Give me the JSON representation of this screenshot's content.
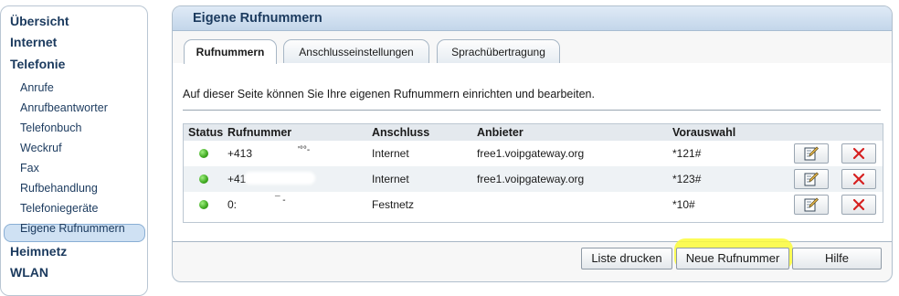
{
  "sidebar": {
    "items": [
      {
        "label": "Übersicht"
      },
      {
        "label": "Internet"
      },
      {
        "label": "Telefonie"
      },
      {
        "label": "Anrufe"
      },
      {
        "label": "Anrufbeantworter"
      },
      {
        "label": "Telefonbuch"
      },
      {
        "label": "Weckruf"
      },
      {
        "label": "Fax"
      },
      {
        "label": "Rufbehandlung"
      },
      {
        "label": "Telefoniegeräte"
      },
      {
        "label": "Eigene Rufnummern"
      },
      {
        "label": "Heimnetz"
      },
      {
        "label": "WLAN"
      }
    ]
  },
  "panel": {
    "title": "Eigene Rufnummern",
    "tabs": [
      {
        "label": "Rufnummern"
      },
      {
        "label": "Anschlusseinstellungen"
      },
      {
        "label": "Sprachübertragung"
      }
    ],
    "intro": "Auf dieser Seite können Sie Ihre eigenen Rufnummern einrichten und bearbeiten."
  },
  "table": {
    "headers": [
      "Status",
      "Rufnummer",
      "Anschluss",
      "Anbieter",
      "Vorauswahl"
    ],
    "rows": [
      {
        "status": "active",
        "number": "+413",
        "number_tail": "'°°-",
        "connection": "Internet",
        "provider": "free1.voipgateway.org",
        "preselect": "*121#"
      },
      {
        "status": "active",
        "number": "+41",
        "number_tail": "",
        "connection": "Internet",
        "provider": "free1.voipgateway.org",
        "preselect": "*123#"
      },
      {
        "status": "active",
        "number": "0:",
        "number_tail": "¯ -",
        "connection": "Festnetz",
        "provider": "",
        "preselect": "*10#"
      }
    ],
    "edit_icon": "edit-icon",
    "delete_icon": "delete-icon"
  },
  "buttons": {
    "print": "Liste drucken",
    "new": "Neue Rufnummer",
    "help": "Hilfe"
  },
  "colors": {
    "highlight": "#fbfb3a",
    "status_green": "#3da71f",
    "delete_red": "#d62020"
  }
}
